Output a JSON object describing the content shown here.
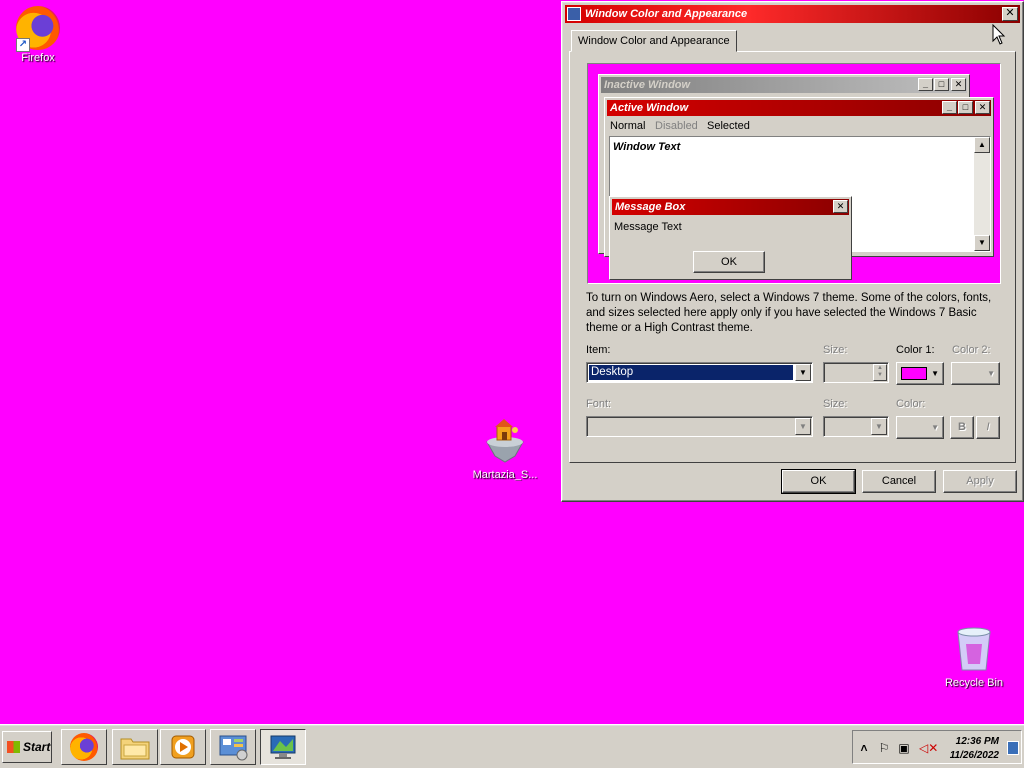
{
  "desktop": {
    "background_color": "#ff00ff",
    "icons": [
      {
        "label": "Firefox",
        "icon": "firefox-icon"
      },
      {
        "label": "Martazia_S...",
        "icon": "floating-island-icon"
      },
      {
        "label": "Recycle Bin",
        "icon": "recycle-bin-icon"
      }
    ]
  },
  "dialog": {
    "title": "Window Color and Appearance",
    "close_glyph": "✕",
    "tab_label": "Window Color and Appearance",
    "preview": {
      "inactive_window_title": "Inactive Window",
      "active_window_title": "Active Window",
      "menu_normal": "Normal",
      "menu_disabled": "Disabled",
      "menu_selected": "Selected",
      "window_text": "Window Text",
      "message_box_title": "Message Box",
      "message_text": "Message Text",
      "ok_label": "OK"
    },
    "description": "To turn on Windows Aero, select a Windows 7 theme.  Some of the colors, fonts, and sizes selected here apply only if you have selected the Windows 7 Basic theme or a High Contrast theme.",
    "item_label": "Item:",
    "item_value": "Desktop",
    "size_label": "Size:",
    "color1_label": "Color 1:",
    "color1_value": "#ff00ff",
    "color2_label": "Color 2:",
    "font_label": "Font:",
    "font_size_label": "Size:",
    "font_color_label": "Color:",
    "bold_label": "B",
    "italic_label": "I",
    "ok_button": "OK",
    "cancel_button": "Cancel",
    "apply_button": "Apply"
  },
  "taskbar": {
    "start_label": "Start",
    "pinned": [
      "firefox-icon",
      "folder-icon",
      "media-player-icon",
      "control-panel-icon",
      "display-settings-icon"
    ],
    "clock_time": "12:36 PM",
    "clock_date": "11/26/2022"
  },
  "colors": {
    "title_active": "#d40000",
    "selection": "#0a246a",
    "face": "#d4d0c8"
  }
}
